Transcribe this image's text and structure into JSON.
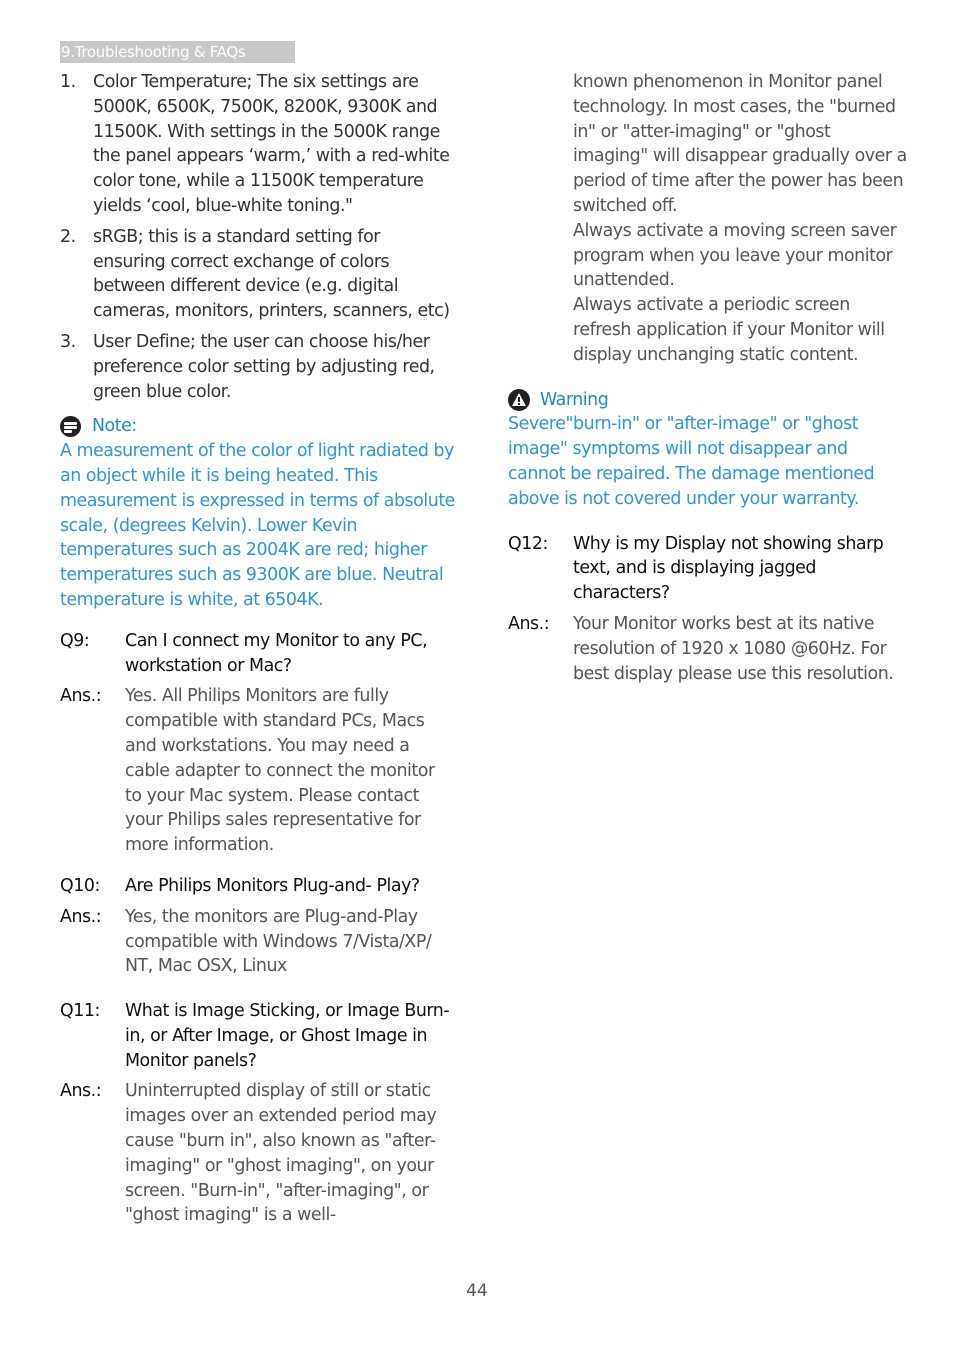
{
  "header": {
    "section_title": "9.Troubleshooting & FAQs"
  },
  "left_column": {
    "numbered_list": [
      {
        "number": "1.",
        "text": "Color Temperature; The six settings are 5000K, 6500K, 7500K, 8200K, 9300K and 11500K. With settings in the 5000K range the panel appears ‘warm,’ with a red-white color tone, while a 11500K temperature yields ‘cool, blue-white toning.\""
      },
      {
        "number": "2.",
        "text": "sRGB; this is a standard setting for ensuring correct exchange of colors between different device (e.g. digital cameras, monitors, printers, scanners, etc)"
      },
      {
        "number": "3.",
        "text": "User Define; the user can choose his/her preference color setting by adjusting red, green blue color."
      }
    ],
    "note": {
      "icon": "note-icon",
      "title": "Note:",
      "body": "A measurement of the color of light radiated by an object while it is being heated. This measurement is expressed in terms of absolute scale, (degrees Kelvin). Lower Kevin temperatures such as 2004K are red; higher temperatures such as 9300K are blue. Neutral temperature is white, at 6504K."
    },
    "faqs": [
      {
        "q_label": "Q9:",
        "question": "Can I connect my Monitor to any PC, workstation or Mac?",
        "a_label": "Ans.:",
        "answer": "Yes. All Philips Monitors are fully compatible with standard PCs, Macs and workstations. You may need a cable adapter to connect the monitor to your Mac system. Please contact your Philips sales representative for more information."
      },
      {
        "q_label": "Q10:",
        "question": "Are Philips Monitors Plug-and- Play?",
        "a_label": "Ans.:",
        "answer": "Yes, the monitors are Plug-and-Play compatible with Windows 7/Vista/XP/ NT, Mac OSX, Linux"
      },
      {
        "q_label": "Q11:",
        "question": "What is Image Sticking, or Image Burn-in, or After Image, or Ghost Image in Monitor panels?",
        "a_label": "Ans.:",
        "answer": "Uninterrupted display of still or static images over an extended period may cause \"burn in\", also known as \"after-imaging\" or \"ghost imaging\", on your screen. \"Burn-in\", \"after-imaging\", or \"ghost imaging\" is a well-"
      }
    ]
  },
  "right_column": {
    "continuation": [
      "known phenomenon in Monitor panel technology. In most cases, the \"burned in\" or \"atter-imaging\" or \"ghost imaging\" will disappear gradually over a period of time after the power has been switched off.",
      "Always activate a moving screen saver program when you leave your monitor unattended.",
      "Always activate a periodic screen refresh application if your Monitor will display unchanging static content."
    ],
    "warning": {
      "icon": "warning-icon",
      "title": "Warning",
      "body": "Severe\"burn-in\" or \"after-image\" or \"ghost image\" symptoms will not disappear and cannot be repaired. The damage mentioned above is not covered under your warranty."
    },
    "faqs": [
      {
        "q_label": "Q12:",
        "question": "Why is my Display not showing sharp text, and is displaying jagged characters?",
        "a_label": "Ans.:",
        "answer": "Your Monitor works best at its native resolution of 1920 x 1080 @60Hz. For best display please use this resolution."
      }
    ]
  },
  "footer": {
    "page_number": "44"
  },
  "colors": {
    "accent_blue": "#2e96d3",
    "header_gray": "#c8c8c8"
  }
}
